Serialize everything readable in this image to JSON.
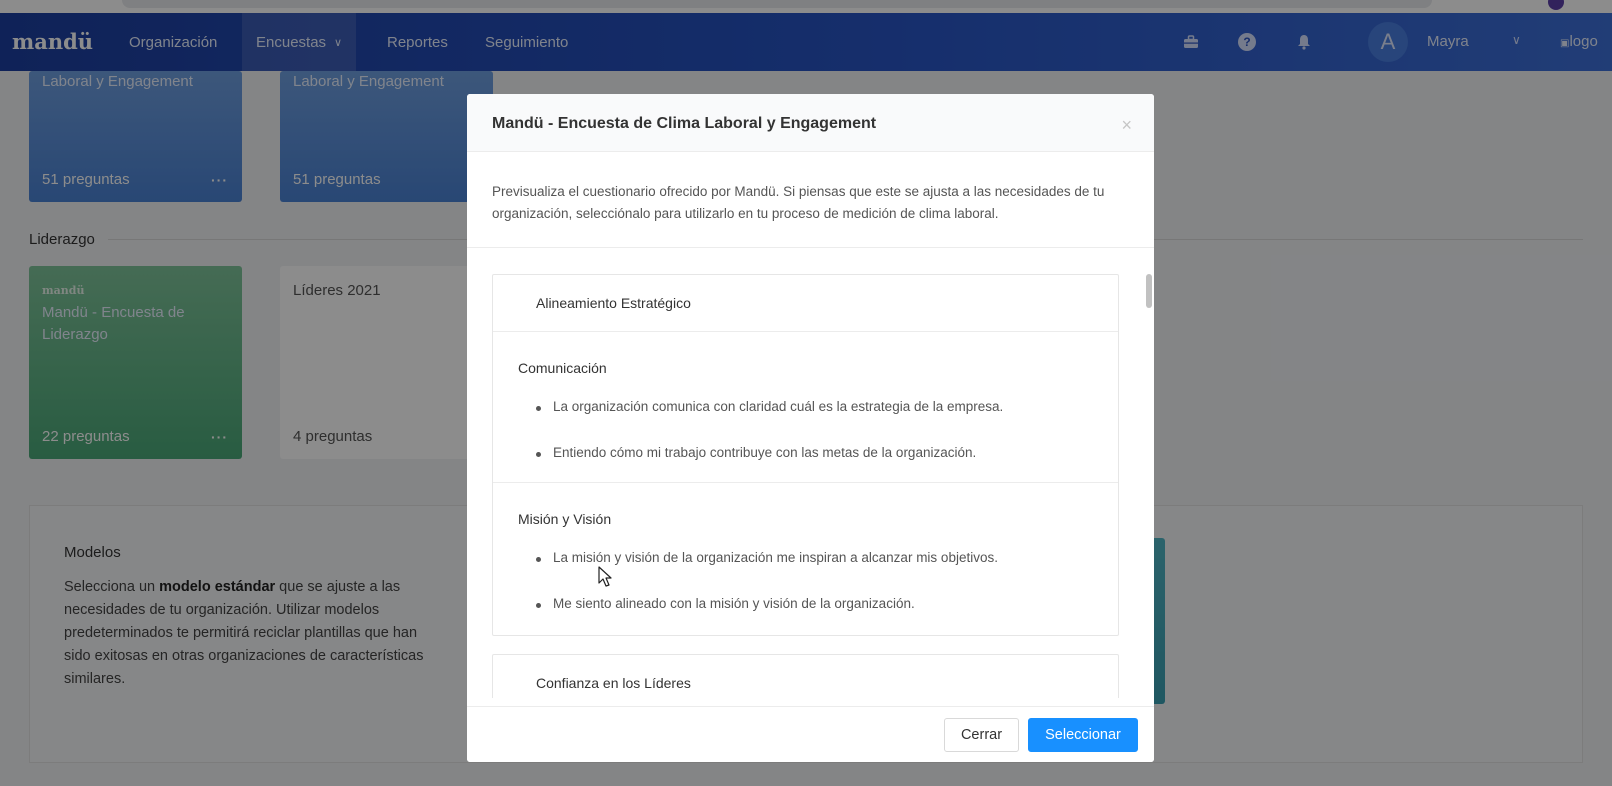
{
  "navbar": {
    "brand": "mandü",
    "items": [
      {
        "label": "Organización"
      },
      {
        "label": "Encuestas"
      },
      {
        "label": "Reportes"
      },
      {
        "label": "Seguimiento"
      }
    ],
    "user_initial": "A",
    "user_name": "Mayra",
    "logo_alt": "logo"
  },
  "background": {
    "cards_top": [
      {
        "title": "Laboral y Engagement",
        "count": "51 preguntas",
        "more": "···"
      },
      {
        "title": "Laboral y Engagement",
        "count": "51 preguntas"
      }
    ],
    "section_label": "Liderazgo",
    "cards_leader": [
      {
        "brand": "mandü",
        "title": "Mandü - Encuesta de Liderazgo",
        "count": "22 preguntas",
        "more": "···"
      },
      {
        "title": "Líderes 2021",
        "count": "4 preguntas"
      }
    ],
    "modelos": {
      "title": "Modelos",
      "text_pre": "Selecciona un ",
      "text_bold": "modelo estándar",
      "text_post": " que se ajuste a las necesidades de tu organización. Utilizar modelos predeterminados te permitirá reciclar plantillas que han sido exitosas en otras organizaciones de características similares."
    }
  },
  "modal": {
    "title": "Mandü - Encuesta de Clima Laboral y Engagement",
    "close": "×",
    "description": "Previsualiza el cuestionario ofrecido por Mandü. Si piensas que este se ajusta a las necesidades de tu organización, selecciónalo para utilizarlo en tu proceso de medición de clima laboral.",
    "panels": [
      {
        "title": "Alineamiento Estratégico",
        "groups": [
          {
            "title": "Comunicación",
            "questions": [
              "La organización comunica con claridad cuál es la estrategia de la empresa.",
              "Entiendo cómo mi trabajo contribuye con las metas de la organización."
            ]
          },
          {
            "title": "Misión y Visión",
            "questions": [
              "La misión y visión de la organización me inspiran a alcanzar mis objetivos.",
              "Me siento alineado con la misión y visión de la organización."
            ]
          }
        ]
      },
      {
        "title": "Confianza en los Líderes"
      }
    ],
    "buttons": {
      "close": "Cerrar",
      "select": "Seleccionar"
    }
  }
}
